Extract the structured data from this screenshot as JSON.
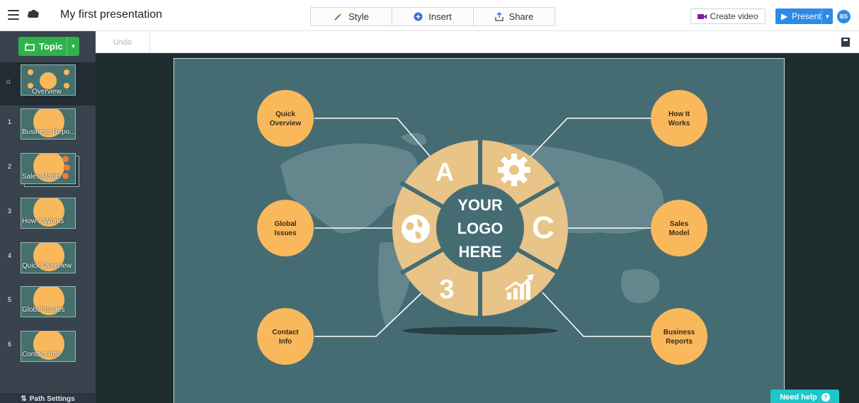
{
  "app": {
    "title": "My first presentation"
  },
  "toolbar": {
    "style_label": "Style",
    "insert_label": "Insert",
    "share_label": "Share",
    "create_video_label": "Create video",
    "present_label": "Present",
    "user_initials": "BS"
  },
  "subbar": {
    "undo_label": "Undo"
  },
  "sidebar": {
    "topic_label": "Topic",
    "overview_label": "Overview",
    "path_settings_label": "Path Settings",
    "slides": [
      {
        "num": "1",
        "label": "Business Repo..."
      },
      {
        "num": "2",
        "label": "Sales Model"
      },
      {
        "num": "3",
        "label": "How It Works"
      },
      {
        "num": "4",
        "label": "Quick Overview"
      },
      {
        "num": "5",
        "label": "Global Issues"
      },
      {
        "num": "6",
        "label": "Contact Info"
      }
    ]
  },
  "slide": {
    "nodes": {
      "quick_overview": "Quick\nOverview",
      "global_issues": "Global\nIssues",
      "contact_info": "Contact\nInfo",
      "how_it_works": "How It\nWorks",
      "sales_model": "Sales\nModel",
      "business_reports": "Business\nReports"
    },
    "center_logo": [
      "YOUR",
      "LOGO",
      "HERE"
    ],
    "segments": {
      "a": "A",
      "c": "C",
      "three": "3"
    }
  },
  "help": {
    "label": "Need help"
  },
  "colors": {
    "accent": "#2f8ae6",
    "topic": "#2eb24a",
    "orange": "#f9b85c",
    "slide_bg": "#466c73",
    "ring": "#e8c489",
    "help": "#1ec6c8"
  }
}
